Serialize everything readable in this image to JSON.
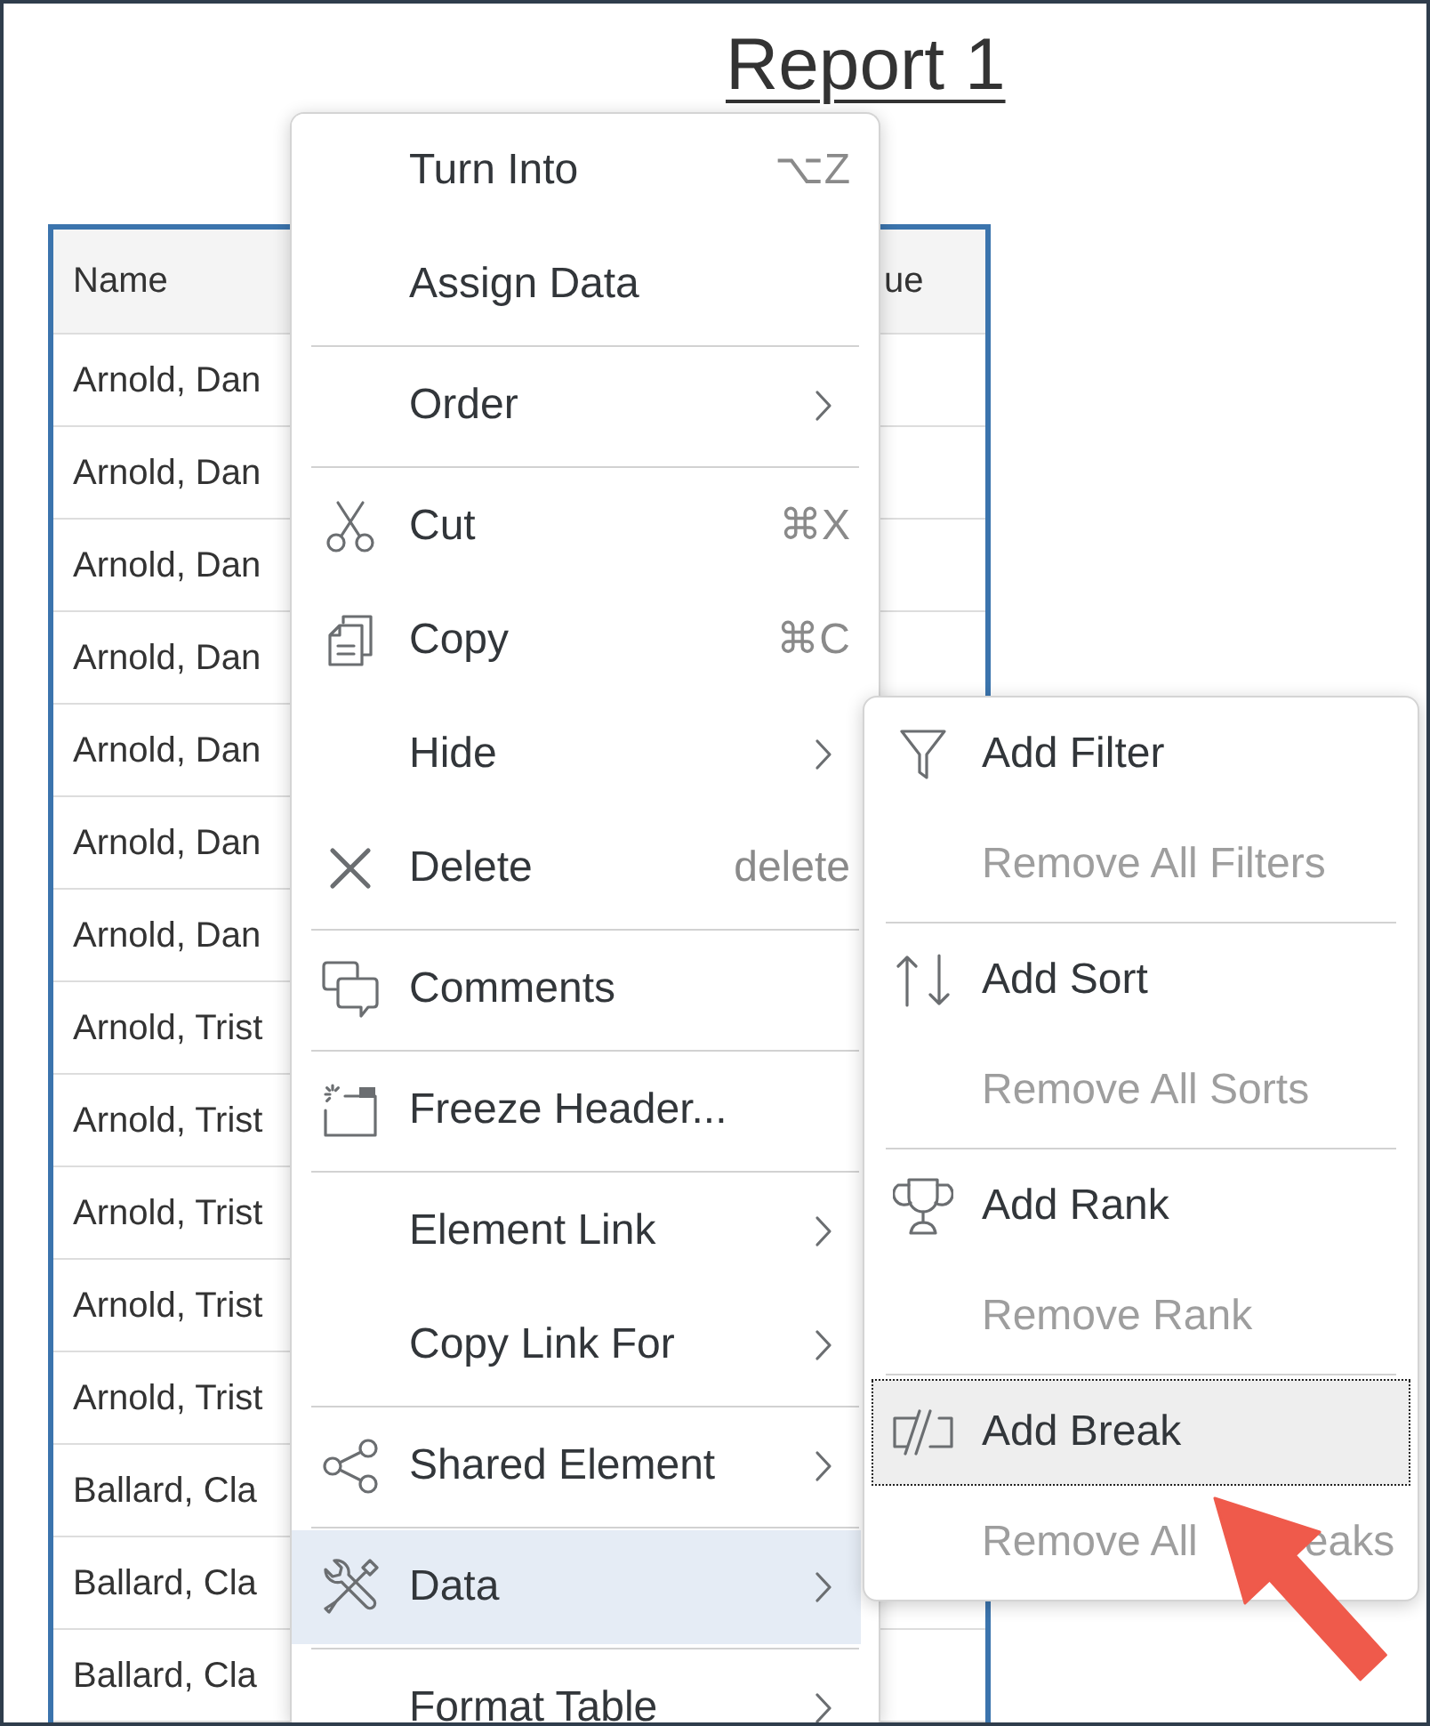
{
  "report": {
    "title": "Report 1"
  },
  "table": {
    "columns": [
      "Name",
      "ue"
    ],
    "rows": [
      [
        "Arnold, Dan"
      ],
      [
        "Arnold, Dan"
      ],
      [
        "Arnold, Dan"
      ],
      [
        "Arnold, Dan"
      ],
      [
        "Arnold, Dan"
      ],
      [
        "Arnold, Dan"
      ],
      [
        "Arnold, Dan"
      ],
      [
        "Arnold, Trist"
      ],
      [
        "Arnold, Trist"
      ],
      [
        "Arnold, Trist"
      ],
      [
        "Arnold, Trist"
      ],
      [
        "Arnold, Trist"
      ],
      [
        "Ballard, Cla"
      ],
      [
        "Ballard, Cla"
      ],
      [
        "Ballard, Cla"
      ]
    ]
  },
  "context_menu": {
    "groups": [
      [
        {
          "label": "Turn Into",
          "shortcut": "⌥Z",
          "has_submenu": false,
          "selected": false
        },
        {
          "label": "Assign Data",
          "has_submenu": false,
          "selected": false
        }
      ],
      [
        {
          "label": "Order",
          "has_submenu": true,
          "selected": false
        }
      ],
      [
        {
          "label": "Cut",
          "shortcut": "⌘X",
          "has_submenu": false,
          "selected": false
        },
        {
          "label": "Copy",
          "shortcut": "⌘C",
          "has_submenu": false,
          "selected": false
        },
        {
          "label": "Hide",
          "has_submenu": true,
          "selected": false
        },
        {
          "label": "Delete",
          "shortcut": "delete",
          "has_submenu": false,
          "selected": false
        }
      ],
      [
        {
          "label": "Comments",
          "has_submenu": false,
          "selected": false
        }
      ],
      [
        {
          "label": "Freeze Header...",
          "has_submenu": false,
          "selected": false
        }
      ],
      [
        {
          "label": "Element Link",
          "has_submenu": true,
          "selected": false
        },
        {
          "label": "Copy Link For",
          "has_submenu": true,
          "selected": false
        }
      ],
      [
        {
          "label": "Shared Element",
          "has_submenu": true,
          "selected": false
        }
      ],
      [
        {
          "label": "Data",
          "has_submenu": true,
          "selected": true
        }
      ],
      [
        {
          "label": "Format Table",
          "has_submenu": true,
          "selected": false
        }
      ]
    ]
  },
  "submenu": {
    "groups": [
      [
        {
          "label": "Add Filter",
          "disabled": false,
          "selected": false
        },
        {
          "label": "Remove All Filters",
          "disabled": true,
          "selected": false
        }
      ],
      [
        {
          "label": "Add Sort",
          "disabled": false,
          "selected": false
        },
        {
          "label": "Remove All Sorts",
          "disabled": true,
          "selected": false
        }
      ],
      [
        {
          "label": "Add Rank",
          "disabled": false,
          "selected": false
        },
        {
          "label": "Remove Rank",
          "disabled": true,
          "selected": false
        }
      ],
      [
        {
          "label": "Add Break",
          "disabled": false,
          "selected": true
        },
        {
          "label": "Remove All",
          "label_tail": "eaks",
          "disabled": true,
          "selected": false
        }
      ]
    ]
  }
}
